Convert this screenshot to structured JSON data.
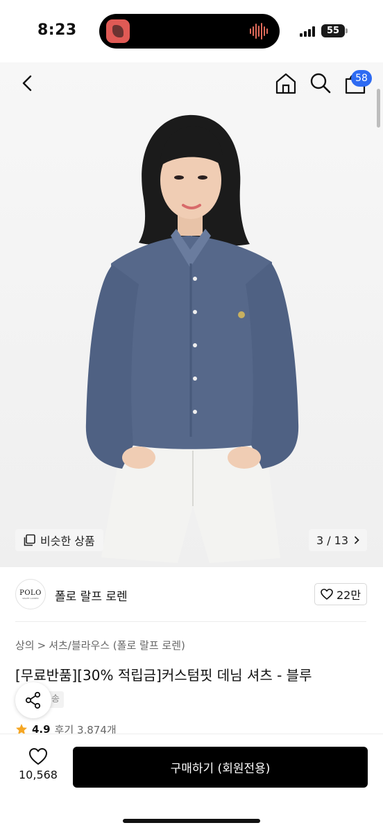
{
  "status": {
    "time": "8:23",
    "battery": "55"
  },
  "nav": {
    "cart_count": "58"
  },
  "gallery": {
    "similar_label": "비슷한 상품",
    "page": "3 / 13"
  },
  "brand": {
    "logo_text": "POLO",
    "logo_sub": "RALPH LAUREN",
    "name": "폴로 랄프 로렌",
    "likes": "22만"
  },
  "breadcrumb": {
    "level1": "상의",
    "sep": ">",
    "level2": "셔츠/블라우스 (폴로 랄프 로렌)"
  },
  "product": {
    "title": "[무료반품][30% 적립금]커스텀핏 데님 셔츠 - 블루",
    "shipping_tag": "송",
    "rating": "4.9",
    "reviews": "후기 3,874개"
  },
  "bottom": {
    "heart_count": "10,568",
    "buy_label": "구매하기 (회원전용)"
  },
  "colors": {
    "badge": "#2e6bf2",
    "buy_button": "#000000",
    "star": "#f5a623",
    "shirt": "#56688a"
  },
  "icons": [
    "back-icon",
    "home-icon",
    "search-icon",
    "cart-icon",
    "similar-icon",
    "chevron-right-icon",
    "heart-icon",
    "share-icon",
    "star-icon"
  ]
}
